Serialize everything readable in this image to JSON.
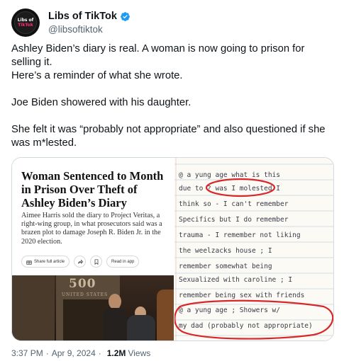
{
  "author": {
    "display_name": "Libs of TikTok",
    "handle": "@libsoftiktok",
    "verified": true,
    "avatar_icon": "libs-of-tiktok-logo-icon",
    "verified_icon": "verified-badge-icon",
    "verified_color": "#1d9bf0"
  },
  "tweet": {
    "paragraphs": [
      "Ashley Biden’s diary is real. A woman is now going to prison for selling it.",
      "Here’s a reminder of what she wrote.",
      "Joe Biden showered with his daughter.",
      "She felt it was “probably not appropriate” and also questioned if she",
      "was m*lested."
    ]
  },
  "media": {
    "article": {
      "headline": "Woman Sentenced to Month in Prison Over Theft of Ashley Biden’s Diary",
      "summary": "Aimee Harris sold the diary to Project Veritas, a right-wing group, in what prosecutors said was a brazen plot to damage Joseph R. Biden Jr. in the 2020 election.",
      "actions": {
        "share_label": "Share full article",
        "share_icon": "gift-icon",
        "forward_icon": "share-arrow-icon",
        "save_icon": "bookmark-icon",
        "app_label": "Read in app"
      },
      "photo_sign": "500",
      "photo_sign_sub": "UNITED STATES"
    },
    "diary": {
      "lines": [
        "@ a yung age   what is this",
        "due to ?  was I molested  I",
        "think so - I can't remember",
        "Specifics but I do remember",
        "trauma - I remember not liking",
        "the weelzacks house ; I",
        "remember somewhat being",
        "Sexualized with caroline ; I",
        "remember being sex with friends",
        "@ a yung age ; Showers w/",
        "my dad (probably not appropriate)"
      ],
      "circle_color": "#d8262b"
    }
  },
  "footer": {
    "time": "3:37 PM",
    "date": "Apr 9, 2024",
    "separator": "·",
    "views_count": "1.2M",
    "views_label": "Views"
  }
}
